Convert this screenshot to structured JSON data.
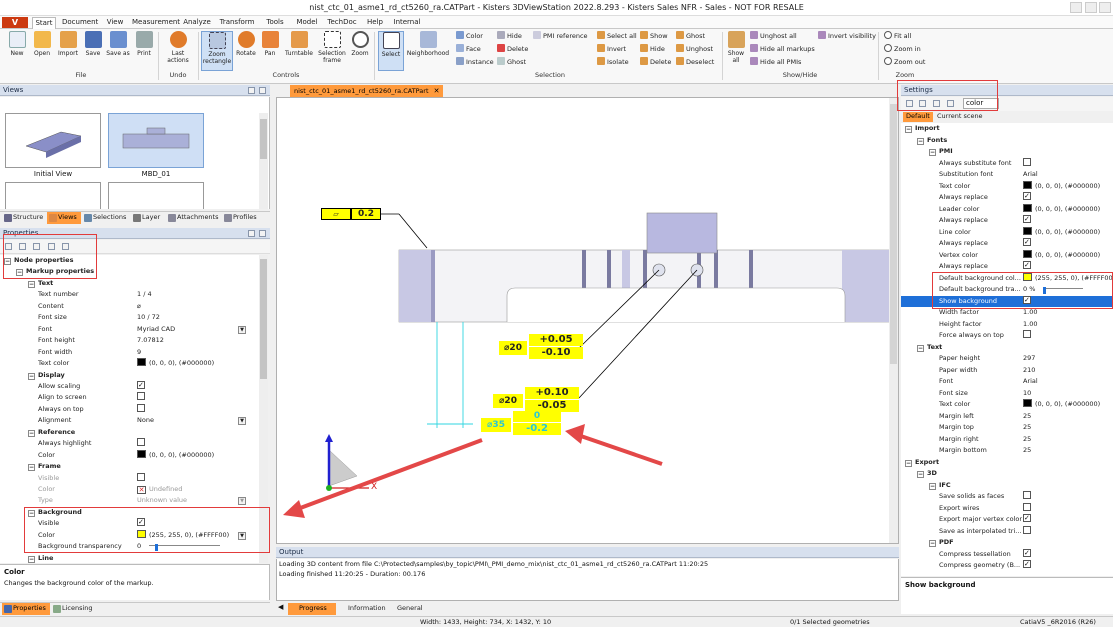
{
  "window": {
    "title": "nist_ctc_01_asme1_rd_ct5260_ra.CATPart - Kisters 3DViewStation 2022.8.293 - Kisters Sales NFR - Sales - NOT FOR RESALE"
  },
  "menubar": {
    "app_button": "V",
    "tabs": [
      "Start",
      "Document",
      "View",
      "Measurement",
      "Analyze",
      "Transform",
      "Tools",
      "Model",
      "TechDoc",
      "Help",
      "Internal"
    ],
    "active": "Start"
  },
  "ribbon": {
    "file": {
      "new": "New",
      "open": "Open",
      "import": "Import",
      "save": "Save",
      "save_as": "Save as",
      "print": "Print",
      "group": "File"
    },
    "undo": {
      "last_actions": "Last actions",
      "group": "Undo"
    },
    "controls": {
      "zoom_rect": "Zoom rectangle",
      "rotate": "Rotate",
      "pan": "Pan",
      "turntable": "Turntable",
      "selection_frame": "Selection frame",
      "zoom": "Zoom",
      "group": "Controls"
    },
    "selection": {
      "select": "Select",
      "neighborhood": "Neighborhood",
      "color": "Color",
      "face": "Face",
      "instance": "Instance",
      "hide": "Hide",
      "delete": "Delete",
      "ghost": "Ghost",
      "pmi_reference": "PMI reference",
      "group": "Selection"
    },
    "selection2": {
      "select_all": "Select all",
      "invert": "Invert",
      "isolate": "Isolate",
      "show": "Show",
      "hide": "Hide",
      "delete": "Delete",
      "ghost": "Ghost",
      "unghost": "Unghost",
      "deselect": "Deselect"
    },
    "showhide": {
      "show_all": "Show all",
      "unghost_all": "Unghost all",
      "hide_all_markups": "Hide all markups",
      "hide_all_pmis": "Hide all PMIs",
      "invert_visibility": "Invert visibility",
      "group": "Show/Hide"
    },
    "zoom": {
      "fit_all": "Fit all",
      "zoom_in": "Zoom in",
      "zoom_out": "Zoom out",
      "group": "Zoom"
    }
  },
  "views_panel": {
    "title": "Views",
    "thumbs": [
      "Initial View",
      "MBD_01"
    ],
    "tabs": [
      "Structure",
      "Views",
      "Selections",
      "Layer",
      "Attachments",
      "Profiles"
    ],
    "active_tab": "Views"
  },
  "properties_panel": {
    "title": "Properties",
    "rows": [
      {
        "type": "sec",
        "indent": 0,
        "label": "Node properties"
      },
      {
        "type": "sec",
        "indent": 1,
        "label": "Markup properties"
      },
      {
        "type": "sec",
        "indent": 2,
        "label": "Text"
      },
      {
        "type": "kv",
        "label": "Text number",
        "value": "1 / 4"
      },
      {
        "type": "kv",
        "label": "Content",
        "value": "⌀"
      },
      {
        "type": "kv",
        "label": "Font size",
        "value": "10 / 72"
      },
      {
        "type": "kv",
        "label": "Font",
        "value": "Myriad CAD",
        "dropdown": true
      },
      {
        "type": "kv",
        "label": "Font height",
        "value": "7.07812"
      },
      {
        "type": "kv",
        "label": "Font width",
        "value": "9"
      },
      {
        "type": "kv",
        "label": "Text color",
        "value": "(0, 0, 0), (#000000)",
        "swatch": "#000000"
      },
      {
        "type": "sec",
        "indent": 2,
        "label": "Display"
      },
      {
        "type": "cb",
        "label": "Allow scaling",
        "checked": true
      },
      {
        "type": "cb",
        "label": "Align to screen",
        "checked": false
      },
      {
        "type": "cb",
        "label": "Always on top",
        "checked": false
      },
      {
        "type": "kv",
        "label": "Alignment",
        "value": "None",
        "dropdown": true
      },
      {
        "type": "sec",
        "indent": 2,
        "label": "Reference"
      },
      {
        "type": "cb",
        "label": "Always highlight",
        "checked": false
      },
      {
        "type": "kv",
        "label": "Color",
        "value": "(0, 0, 0), (#000000)",
        "swatch": "#000000"
      },
      {
        "type": "sec",
        "indent": 2,
        "label": "Frame"
      },
      {
        "type": "cb",
        "label": "Visible",
        "checked": false,
        "dim": true
      },
      {
        "type": "kv",
        "label": "Color",
        "value": "Undefined",
        "swatch": "undef",
        "dim": true
      },
      {
        "type": "kv",
        "label": "Type",
        "value": "Unknown value",
        "dim": true,
        "dropdown": true
      },
      {
        "type": "sec",
        "indent": 2,
        "label": "Background"
      },
      {
        "type": "cb",
        "label": "Visible",
        "checked": true
      },
      {
        "type": "kv",
        "label": "Color",
        "value": "(255, 255, 0), (#FFFF00)",
        "swatch": "#ffff00",
        "dropdown": true
      },
      {
        "type": "slider",
        "label": "Background transparency",
        "value": "0"
      },
      {
        "type": "sec",
        "indent": 2,
        "label": "Line"
      }
    ],
    "help_title": "Color",
    "help_text": "Changes the background color of the markup.",
    "tabs": [
      "Properties",
      "Licensing"
    ]
  },
  "document_tab": "nist_ctc_01_asme1_rd_ct5260_ra.CATPart",
  "viewport": {
    "flatness": "0.2",
    "dia1": "⌀20",
    "tol1_up": "+0.05",
    "tol1_lo": "-0.10",
    "dia2": "⌀20",
    "tol2_up": "+0.10",
    "tol2_lo": "-0.05",
    "dia3": "⌀35",
    "tol3_up": "0",
    "tol3_lo": "-0.2",
    "axis_x": "X"
  },
  "output_panel": {
    "title": "Output",
    "lines": [
      "Loading 3D content from file C:\\Protected\\samples\\by_topic\\PMI\\_PMI_demo_mix\\nist_ctc_01_asme1_rd_ct5260_ra.CATPart 11:20:25",
      "Loading finished 11:20:25 - Duration: 00.176"
    ],
    "tabs": [
      "Progress",
      "Information",
      "General"
    ],
    "active_tab": "Progress"
  },
  "settings_panel": {
    "title": "Settings",
    "search_value": "color",
    "tabs": [
      "Default",
      "Current scene"
    ],
    "rows": [
      {
        "type": "sec",
        "indent": 0,
        "label": "Import"
      },
      {
        "type": "sec",
        "indent": 1,
        "label": "Fonts"
      },
      {
        "type": "sec",
        "indent": 2,
        "label": "PMI"
      },
      {
        "type": "cb",
        "label": "Always substitute font",
        "checked": false
      },
      {
        "type": "kv",
        "label": "Substitution font",
        "value": "Arial"
      },
      {
        "type": "kv",
        "label": "Text color",
        "value": "(0, 0, 0), (#000000)",
        "swatch": "#000000"
      },
      {
        "type": "cb",
        "label": "Always replace",
        "checked": true
      },
      {
        "type": "kv",
        "label": "Leader color",
        "value": "(0, 0, 0), (#000000)",
        "swatch": "#000000"
      },
      {
        "type": "cb",
        "label": "Always replace",
        "checked": true
      },
      {
        "type": "kv",
        "label": "Line color",
        "value": "(0, 0, 0), (#000000)",
        "swatch": "#000000"
      },
      {
        "type": "cb",
        "label": "Always replace",
        "checked": true
      },
      {
        "type": "kv",
        "label": "Vertex color",
        "value": "(0, 0, 0), (#000000)",
        "swatch": "#000000"
      },
      {
        "type": "cb",
        "label": "Always replace",
        "checked": true
      },
      {
        "type": "kv",
        "label": "Default background col...",
        "value": "(255, 255, 0), (#FFFF00)",
        "swatch": "#ffff00"
      },
      {
        "type": "slider",
        "label": "Default background tra...",
        "value": "0 %"
      },
      {
        "type": "cb",
        "label": "Show background",
        "checked": true,
        "selected": true
      },
      {
        "type": "kv",
        "label": "Width factor",
        "value": "1.00"
      },
      {
        "type": "kv",
        "label": "Height factor",
        "value": "1.00"
      },
      {
        "type": "cb",
        "label": "Force always on top",
        "checked": false
      },
      {
        "type": "sec",
        "indent": 1,
        "label": "Text"
      },
      {
        "type": "kv",
        "label": "Paper height",
        "value": "297"
      },
      {
        "type": "kv",
        "label": "Paper width",
        "value": "210"
      },
      {
        "type": "kv",
        "label": "Font",
        "value": "Arial"
      },
      {
        "type": "kv",
        "label": "Font size",
        "value": "10"
      },
      {
        "type": "kv",
        "label": "Text color",
        "value": "(0, 0, 0), (#000000)",
        "swatch": "#000000"
      },
      {
        "type": "kv",
        "label": "Margin left",
        "value": "25"
      },
      {
        "type": "kv",
        "label": "Margin top",
        "value": "25"
      },
      {
        "type": "kv",
        "label": "Margin right",
        "value": "25"
      },
      {
        "type": "kv",
        "label": "Margin bottom",
        "value": "25"
      },
      {
        "type": "sec",
        "indent": 0,
        "label": "Export"
      },
      {
        "type": "sec",
        "indent": 1,
        "label": "3D"
      },
      {
        "type": "sec",
        "indent": 2,
        "label": "IFC"
      },
      {
        "type": "cb",
        "label": "Save solids as faces",
        "checked": false
      },
      {
        "type": "cb",
        "label": "Export wires",
        "checked": false
      },
      {
        "type": "cb",
        "label": "Export major vertex color",
        "checked": true
      },
      {
        "type": "cb",
        "label": "Save as interpolated tri...",
        "checked": false
      },
      {
        "type": "sec",
        "indent": 2,
        "label": "PDF"
      },
      {
        "type": "cb",
        "label": "Compress tessellation",
        "checked": true
      },
      {
        "type": "cb",
        "label": "Compress geometry (B...",
        "checked": true
      }
    ],
    "help_title": "Show background"
  },
  "statusbar": {
    "dims": "Width: 1433, Height: 734, X: 1432, Y: 10",
    "selected": "0/1 Selected geometries",
    "version": "CatiaV5 _6R2016 (R26)"
  }
}
